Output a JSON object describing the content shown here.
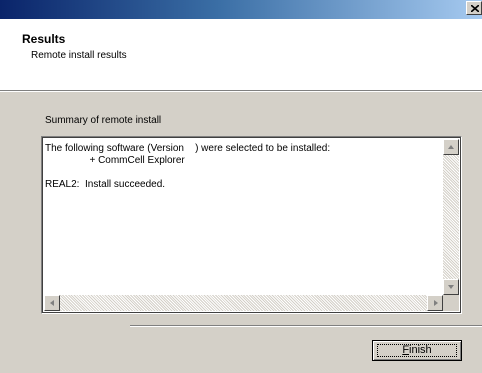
{
  "header": {
    "title": "Results",
    "subtitle": "Remote install results"
  },
  "main": {
    "summary_label": "Summary of remote install",
    "results_lines": [
      "The following software (Version    ) were selected to be installed:",
      "                + CommCell Explorer",
      "",
      "REAL2:  Install succeeded."
    ]
  },
  "footer": {
    "finish_first": "F",
    "finish_rest": "inish"
  },
  "icons": {
    "close": "close-icon",
    "scroll_up": "arrow-up-icon",
    "scroll_down": "arrow-down-icon",
    "scroll_left": "arrow-left-icon",
    "scroll_right": "arrow-right-icon"
  }
}
